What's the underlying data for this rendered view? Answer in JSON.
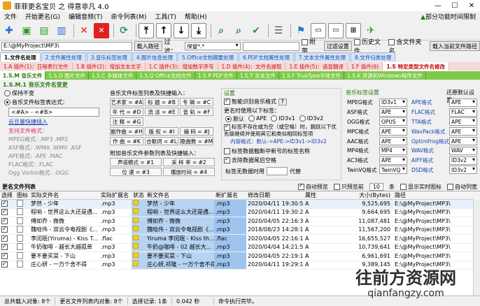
{
  "window": {
    "title": "菲菲更名宝贝 之 得意非凡 4.0"
  },
  "menu": {
    "items": [
      "文件",
      "开始更名(G)",
      "编辑音频(T)",
      "命令列表(M)",
      "工具(T)",
      "帮助(H)"
    ],
    "right_text": "部分功能时间限制"
  },
  "pathbar": {
    "path": "E:\\@MyProject\\MP3\\",
    "import_path": "载入路径",
    "filter_label": "过滤：",
    "filter_value": "保留*.*",
    "include_sub": "附带",
    "filter_btn": "过滤设置",
    "cb_history": "历史文件",
    "cb_folder": "含文件夹名",
    "cb_load": "载入当前文件路径"
  },
  "tabs1": [
    "1.文件名处理",
    "2.文件属性处理",
    "3.音乐标签处理",
    "4.图片信息处理",
    "5.Office文档摘要处理",
    "6.PDF文档属性处理",
    "7.文本文件属性处理",
    "8.文件归类处理"
  ],
  "tabs2": [
    "1.A 插件(1)：日程表行文件",
    "1.B 插件(2)：增加文本文字",
    "1.C 插件(3)：增加数字序号",
    "1.D 插件(4)：文件名提取",
    "1.E 插件(5)：语音翻译",
    "1.F 插件(6)",
    "1.S 特定类型文件名修改"
  ],
  "tabs3": [
    "1.S.M 音乐文件",
    "1.S.O 图片文件",
    "1.S.C 多媒体文件",
    "1.S.O Office文档文件",
    "1.S.P PDF文件",
    "1.S.T 文本文件",
    "1.S.F TrueType字体文件",
    "1.S.K 资源和Windows程序文件"
  ],
  "music_panel": {
    "section_title": "1.S.M.1 音乐文件名变更",
    "opt_keep": "保持不变",
    "opt_tag": "音乐文件标签表达式：",
    "expression": "<#A> - <#B>",
    "cloud_link": "云豆量快捷插入",
    "formats_title": "支持文件格式：",
    "formats": [
      "MPEG格式: .MP3 .MP2",
      "ASF格式: .WMA .WMV .ASF",
      "APE格式: .APE .MAC",
      "FLAC格式: .FLAC",
      "Ogg Vorbis格式: .OGG"
    ],
    "expr_title": "音乐文件标签列表及快捷输入：",
    "tags": [
      [
        "艺术家 = #A",
        "标 题 = #B",
        "专 辑 = #C"
      ],
      [
        "年 代 = #D",
        "流 派 = #E",
        "音 轨 = #F"
      ],
      [
        "注 释 = #G",
        "",
        ""
      ],
      [
        "副作曲 = #H",
        "版 权 = #I",
        "编 码 = #J"
      ],
      [
        "作 曲 = #K",
        "合歌词 = #L",
        "歌曲数 = #M"
      ]
    ],
    "extra_title": "附加音乐文件参数列表及快捷输入：",
    "extra": [
      [
        "声道模式 = #1",
        "采 样 率 = #2"
      ],
      [
        "位 速 = #3",
        "播放时间 = #4"
      ]
    ]
  },
  "settings": {
    "title": "设置",
    "cb_smart": "智能识别音乐格式",
    "cb_smart_btn": "?",
    "tag_prio_title": "更名时使用以下标签：",
    "radios": [
      "默认",
      "APE",
      "ID3v1",
      "ID3v2"
    ],
    "cb_skip": "标签不存在或为空（或空格）时，跳跃以下优先级继续并使用其它和类似相同标签项",
    "priority_label": "内容格式：",
    "priority_value": "默认->APE->ID3v1->ID3v2",
    "cb_limit": "标签数据截断中新号的标签名称",
    "cb_strip": "去除数据尾后空格",
    "empty_label": "标签无数据时用",
    "empty_suffix": "代替"
  },
  "formats_settings": {
    "title": "音乐标签设置",
    "left": [
      [
        "MPEG格式",
        "ID3v1"
      ],
      [
        "ASF格式",
        "APE"
      ],
      [
        "OGG格式",
        "OPUS"
      ],
      [
        "MPC格式",
        "APE"
      ],
      [
        "AAC格式",
        "APE"
      ],
      [
        "MP4格式",
        "MP4"
      ],
      [
        "AC3格式",
        "APE"
      ],
      [
        "TwinVQ格式",
        "TwinVQ"
      ]
    ],
    "right": [
      [
        "APE格式",
        "APE"
      ],
      [
        "FLAC格式",
        "FLAC"
      ],
      [
        "TTA格式",
        "APE"
      ],
      [
        "WavPack格式",
        "APE"
      ],
      [
        "OptimFrog格式",
        "APE"
      ],
      [
        "WAV格式",
        "WAV"
      ],
      [
        "AIFF格式",
        "ID3v2"
      ],
      [
        "DSD格式",
        "ID3v2"
      ]
    ],
    "restore": "还原默认设置"
  },
  "file_list": {
    "title": "更名文件列表",
    "cb_preview": "自动预览",
    "cb_only_first": "只预览前",
    "first_n": "10",
    "unit": "条",
    "cb_icons": "显示实时图标",
    "cb_auto": "自动列宽",
    "headers": [
      "选择",
      "图标",
      "实际文件名",
      "实际扩展名",
      "状态",
      "新文件名",
      "新扩展名",
      "修改日期",
      "属性",
      "大小(Bytes)",
      "路径"
    ],
    "rows": [
      [
        "梦然 - 少年",
        ".mp3",
        "梦然 - 少年",
        ".mp3",
        "2020/04/11 19:30:52",
        "A",
        "9,525,695",
        "E:\\@MyProject\\MP3\\"
      ],
      [
        "程响 - 世界这么大还是遇...",
        ".mp3",
        "程响 - 世界这么大还是遇...",
        ".mp3",
        "2020/04/11 19:30:24",
        "A",
        "9,664,695",
        "E:\\@MyProject\\MP3\\"
      ],
      [
        "傅如乔 - 微微",
        ".mp3",
        "傅如乔 - 微微",
        ".mp3",
        "2020/04/05 22:16:37",
        "A",
        "11,087,481",
        "E:\\@MyProject\\MP3\\"
      ],
      [
        "魏晗伟 - 双云令电视剧《...",
        ".mp3",
        "魏晗伟 - 双云令电视剧《...",
        ".mp3",
        "2018/08/23 14:28:16",
        "A",
        "11,567,200",
        "E:\\@MyProject\\MP3\\"
      ],
      [
        "李闰珉(Yiruma) - Kiss T...",
        ".flac",
        "Yiruma 李闰珉 - Kiss th...",
        ".flac",
        "2020/04/05 22:16:12",
        "A",
        "16,655,527",
        "E:\\@MyProject\\MP3\\"
      ],
      [
        "牛奶咖啡 - 越长大越孤单",
        ".mp3",
        "牛奶@咖啡 - 02 越长大...",
        ".mp3",
        "2020/04/04 14:21:50",
        "A",
        "10,739,641",
        "E:\\@MyProject\\MP3\\"
      ],
      [
        "要不要买菜 - 下山",
        ".mp3",
        "要不要买菜 - 下山",
        ".mp3",
        "2020/04/05 22:19:16",
        "A",
        "6,961,691",
        "E:\\@MyProject\\MP3\\"
      ],
      [
        "庄心妍 - 一万个舍不得",
        ".mp3",
        "庄心妍,祁隆 - 一万个舍不得",
        ".mp3",
        "2020/04/11 19:29:16",
        "A",
        "9,389,145",
        "E:\\@MyProject\\MP3\\"
      ]
    ]
  },
  "status": {
    "total": "总共载入对象: 8个",
    "changed": "更名文件列表内对象: 8个",
    "selected": "选择记录: 1条",
    "size": "0.042 秒",
    "state": "命令执行完毕。"
  },
  "watermark": {
    "cn": "往前方资源网",
    "en": "qianfangzy.com"
  },
  "colors": {
    "tab_active_green": "#7ec94a",
    "tab_pink": "#f7d9d9",
    "row_highlight": "#b6d3f2",
    "accent_blue": "#1f4e9e"
  }
}
